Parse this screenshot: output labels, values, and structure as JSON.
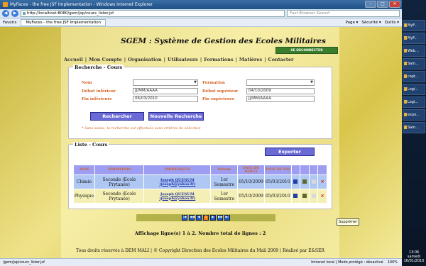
{
  "window": {
    "title": "MyFaces - the free JSF Implementation - Windows Internet Explorer"
  },
  "browser": {
    "url": "http://localhost:8080/gem/jsp/cours_lister.jsf",
    "search_placeholder": "Fast Browser Search",
    "favorites": "Favoris",
    "tab": "MyFaces - the free JSF Implementation",
    "tools": [
      "Page ▾",
      "Sécurité ▾",
      "Outils ▾"
    ]
  },
  "page": {
    "title": "SGEM : Système de Gestion des Ecoles Militaires",
    "logout": "SE DECONNECTER",
    "menu": [
      "Accueil",
      "|",
      "Mon Compte",
      "|",
      "Organisation",
      "|",
      "Utilisateurs",
      "|",
      "Formations",
      "|",
      "Matières",
      "|",
      "Contacter"
    ]
  },
  "search": {
    "legend": "Recherche - Cours",
    "nom_label": "Nom",
    "formation_label": "Formation",
    "debut_inf_label": "Début inférieur",
    "debut_inf_value": "JJ/MM/AAAA",
    "debut_sup_label": "Début supérieur",
    "debut_sup_value": "04/10/2009",
    "fin_inf_label": "Fin inférieure",
    "fin_inf_value": "06/03/2010",
    "fin_sup_label": "Fin supérieure",
    "fin_sup_value": "JJ/MM/AAAA",
    "btn_search": "Rechercher",
    "btn_new": "Nouvelle Recherche",
    "note": "* Sans saisie, la recherche est effectuée sans critères de sélection"
  },
  "list": {
    "legend": "Liste - Cours",
    "export": "Exporter",
    "headers": [
      "NOM",
      "FORMATION",
      "PROFESSEUR",
      "Période",
      "DATE DE DEBUT",
      "DATE DE FIN"
    ],
    "rows": [
      {
        "nom": "Chimie",
        "formation": "Seconde (Ecole Prytanée)",
        "prof": "Joseph QUENUM",
        "email": "(joseph@yahoo.fr)",
        "periode": "1er Semestre",
        "debut": "05/10/2009",
        "fin": "05/03/2010"
      },
      {
        "nom": "Physique",
        "formation": "Seconde (Ecole Prytanée)",
        "prof": "Joseph QUENUM",
        "email": "(joseph@yahoo.fr)",
        "periode": "1er Semestre",
        "debut": "05/10/2009",
        "fin": "05/03/2010"
      }
    ],
    "tooltip": "Supprimer",
    "summary": "Affichage ligne(s) 1 à 2. Nombre total de lignes : 2"
  },
  "footer": "Tous droits réservés à DEM MALI | © Copyright Direction des Ecoles Militaires du Mali 2009 | Réalisé par E&SER",
  "status": {
    "path": "/gem/jsp/cours_lister.jsf",
    "zone": "Intranet local | Mode protégé : désactivé",
    "zoom": "100%"
  },
  "taskbar": {
    "items": [
      "MyF...",
      "MyF...",
      "Web...",
      "Sam...",
      "capt...",
      "Logi...",
      "Logi...",
      "expo...",
      "Sam..."
    ],
    "time": "13:06",
    "day": "samedi",
    "date": "16/01/2010"
  }
}
